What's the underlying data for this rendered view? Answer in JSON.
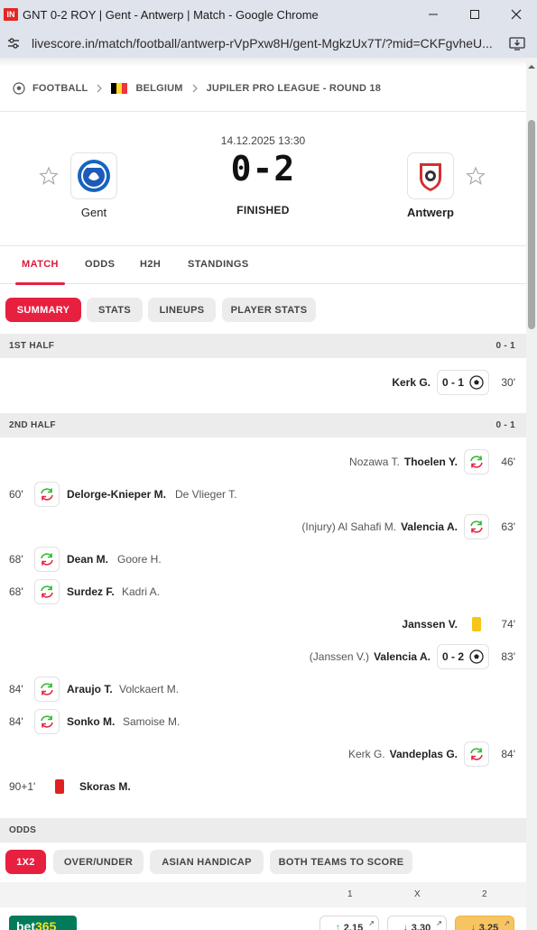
{
  "browser": {
    "favicon_text": "IN",
    "window_title": "GNT 0-2 ROY | Gent - Antwerp | Match - Google Chrome",
    "url": "livescore.in/match/football/antwerp-rVpPxw8H/gent-MgkzUx7T/?mid=CKFgvheU...",
    "controls": [
      "minimize-icon",
      "maximize-icon",
      "close-icon"
    ]
  },
  "breadcrumb": {
    "sport": "FOOTBALL",
    "country": "BELGIUM",
    "competition": "JUPILER PRO LEAGUE - ROUND 18"
  },
  "match": {
    "datetime": "14.12.2025 13:30",
    "score": "0-2",
    "status": "FINISHED",
    "home_team": "Gent",
    "away_team": "Antwerp"
  },
  "tabs": [
    "MATCH",
    "ODDS",
    "H2H",
    "STANDINGS"
  ],
  "active_tab": "MATCH",
  "subtabs": [
    "SUMMARY",
    "STATS",
    "LINEUPS",
    "PLAYER STATS"
  ],
  "active_subtab": "SUMMARY",
  "sections": [
    {
      "label": "1ST HALF",
      "score": "0 - 1",
      "events": [
        {
          "side": "away",
          "type": "goal",
          "minute": "30'",
          "player": "Kerk G.",
          "score": "0 - 1"
        }
      ]
    },
    {
      "label": "2ND HALF",
      "score": "0 - 1",
      "events": [
        {
          "side": "away",
          "type": "substitution",
          "minute": "46'",
          "player": "Thoelen Y.",
          "assist": "Nozawa T."
        },
        {
          "side": "home",
          "type": "substitution",
          "minute": "60'",
          "player": "Delorge-Knieper M.",
          "assist": "De Vlieger T."
        },
        {
          "side": "away",
          "type": "substitution",
          "minute": "63'",
          "player": "Valencia A.",
          "assist": "(Injury) Al Sahafi M."
        },
        {
          "side": "home",
          "type": "substitution",
          "minute": "68'",
          "player": "Dean M.",
          "assist": "Goore H."
        },
        {
          "side": "home",
          "type": "substitution",
          "minute": "68'",
          "player": "Surdez F.",
          "assist": "Kadri A."
        },
        {
          "side": "away",
          "type": "yellow-card",
          "minute": "74'",
          "player": "Janssen V."
        },
        {
          "side": "away",
          "type": "goal",
          "minute": "83'",
          "player": "Valencia A.",
          "assist": "(Janssen V.)",
          "score": "0 - 2"
        },
        {
          "side": "home",
          "type": "substitution",
          "minute": "84'",
          "player": "Araujo T.",
          "assist": "Volckaert M."
        },
        {
          "side": "home",
          "type": "substitution",
          "minute": "84'",
          "player": "Sonko M.",
          "assist": "Samoise M."
        },
        {
          "side": "away",
          "type": "substitution",
          "minute": "84'",
          "player": "Vandeplas G.",
          "assist": "Kerk G."
        },
        {
          "side": "home",
          "type": "red-card",
          "minute": "90+1'",
          "player": "Skoras M."
        }
      ]
    }
  ],
  "odds": {
    "label": "ODDS",
    "markets": [
      "1X2",
      "OVER/UNDER",
      "ASIAN HANDICAP",
      "BOTH TEAMS TO SCORE"
    ],
    "active_market": "1X2",
    "columns": [
      "1",
      "X",
      "2"
    ],
    "bookmaker": {
      "name_white": "bet",
      "name_yellow": "365"
    },
    "values": [
      {
        "value": "2.15",
        "trend": "up"
      },
      {
        "value": "3.30",
        "trend": "down"
      },
      {
        "value": "3.25",
        "trend": "down"
      }
    ],
    "external_icon": "↗"
  },
  "colors": {
    "accent": "#e8203f",
    "titlebar": "#dfe3eb",
    "section_bg": "#ececec",
    "bet365_green": "#027b5b",
    "yellow_card": "#f5c518",
    "red_card": "#e02020",
    "sub_in": "#2eb82e",
    "sub_out": "#e8203f"
  }
}
